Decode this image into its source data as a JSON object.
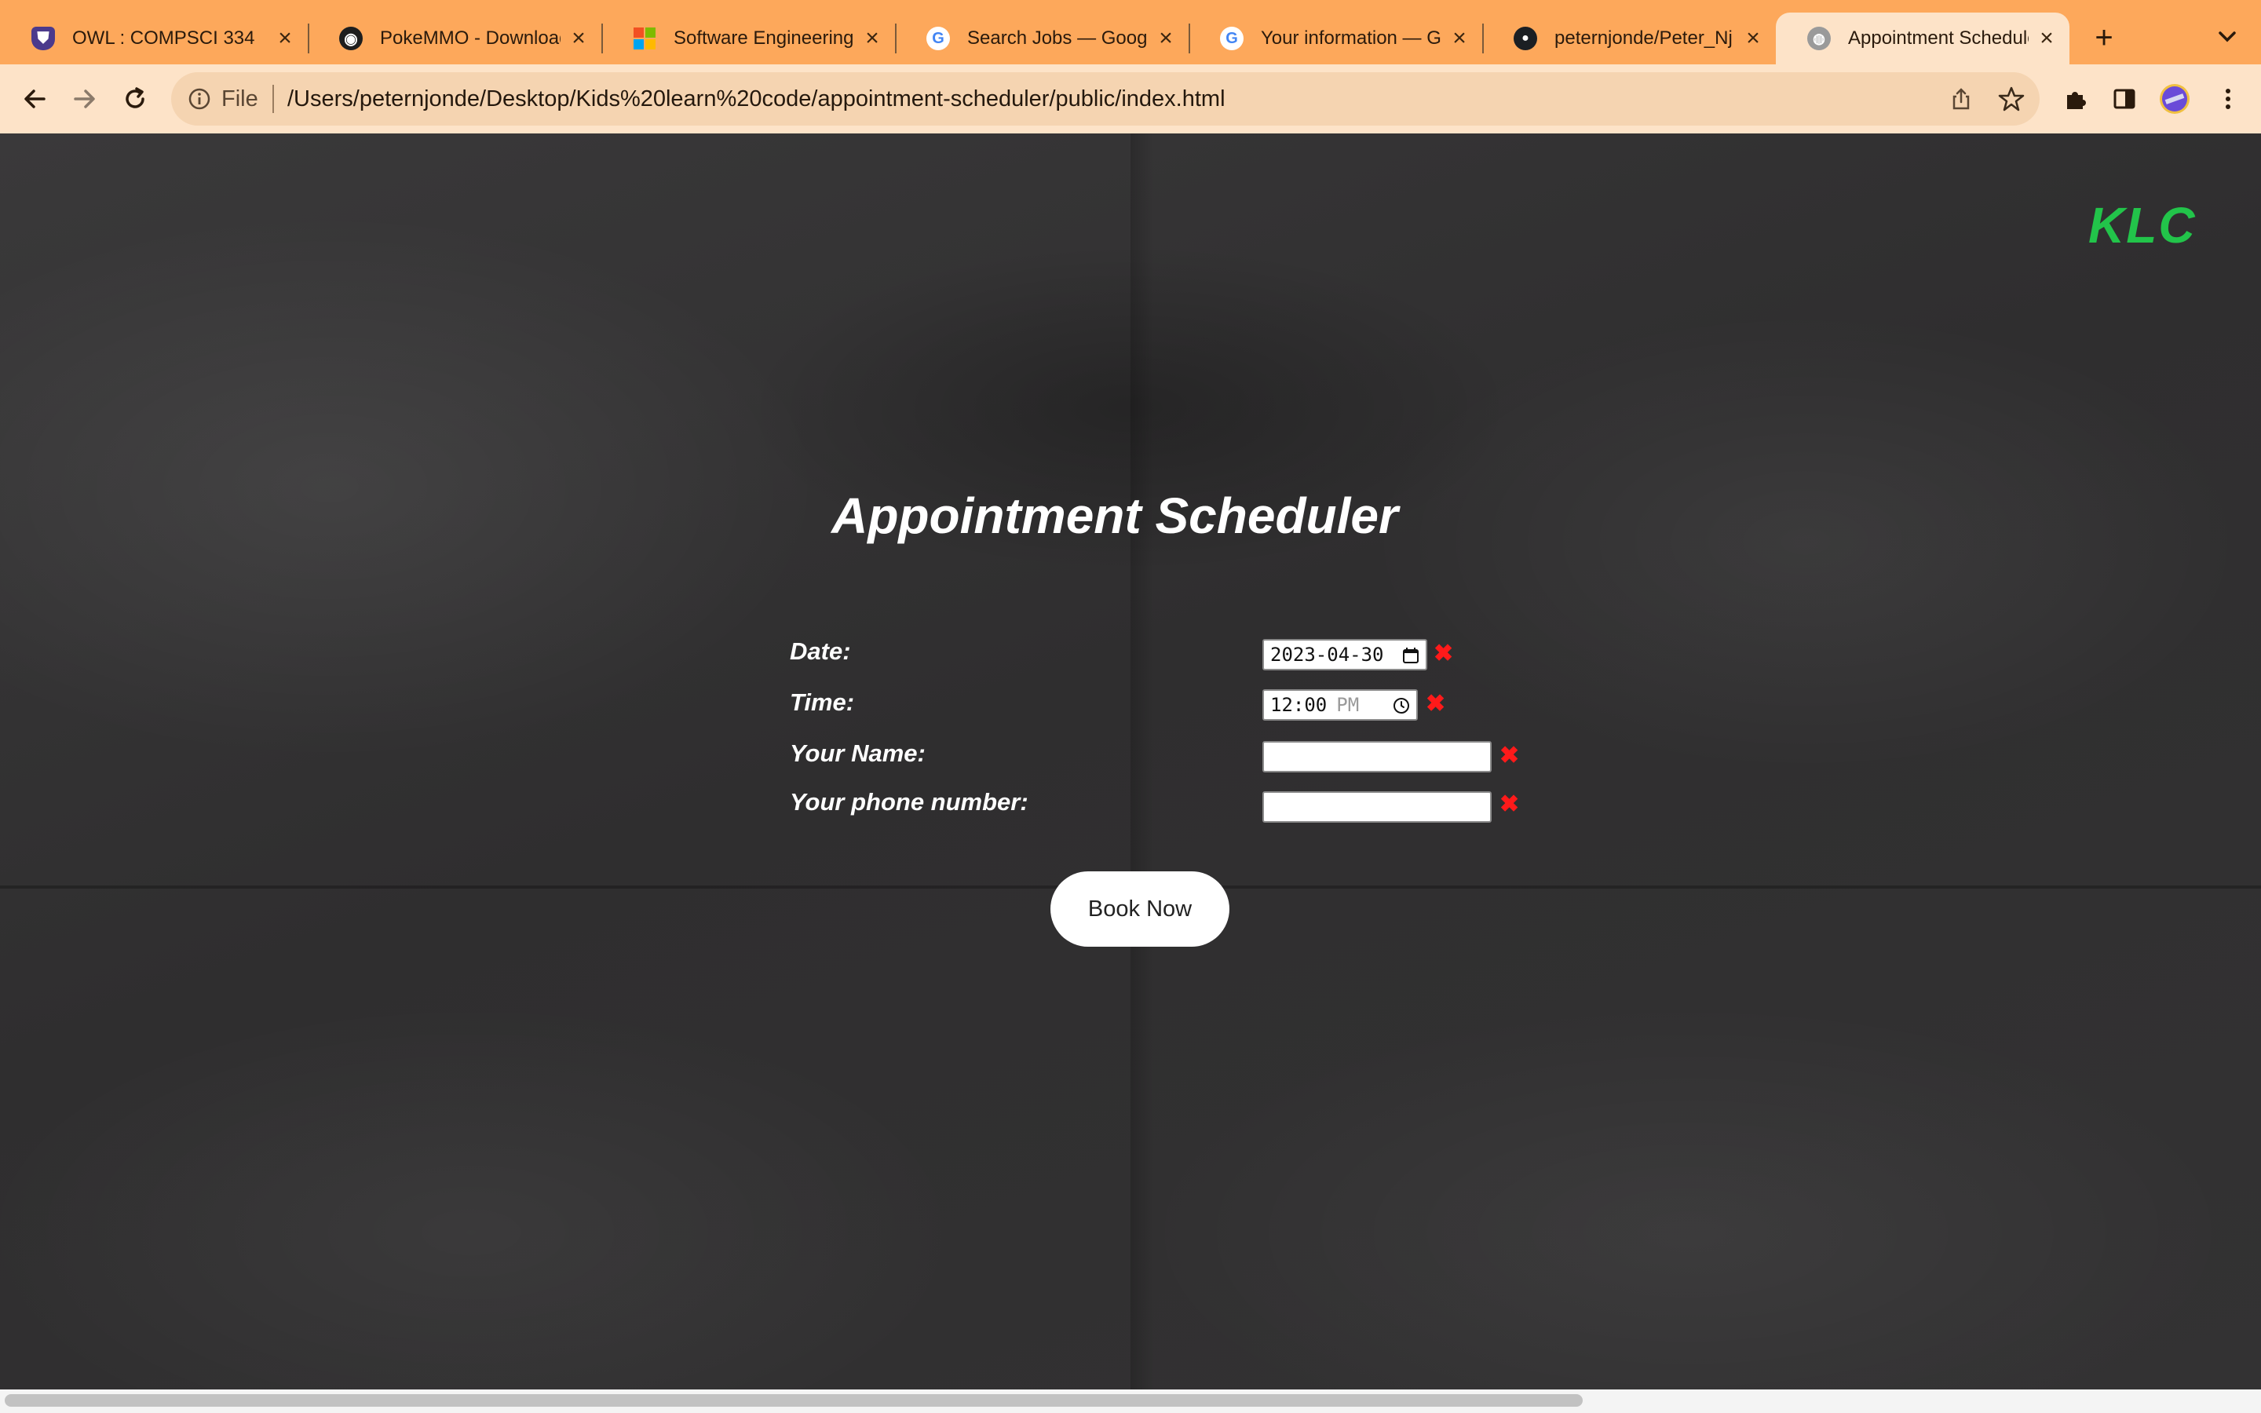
{
  "browser": {
    "tabs": [
      {
        "title": "OWL : COMPSCI 334",
        "icon": "owl-shield-icon",
        "color": "#4b3a8c"
      },
      {
        "title": "PokeMMO - Download",
        "icon": "pokemmo-icon",
        "color": "#222222"
      },
      {
        "title": "Software Engineering",
        "icon": "microsoft-icon",
        "color": "#f25022"
      },
      {
        "title": "Search Jobs — Google",
        "icon": "google-icon",
        "color": "#4285f4"
      },
      {
        "title": "Your information — Google",
        "icon": "google-icon",
        "color": "#4285f4"
      },
      {
        "title": "peternjonde/Peter_Nj",
        "icon": "github-icon",
        "color": "#1b1f23"
      },
      {
        "title": "Appointment Scheduler",
        "icon": "globe-icon",
        "color": "#8a8a8a"
      }
    ],
    "active_tab": 6,
    "address": {
      "scheme_label": "File",
      "url": "/Users/peternjonde/Desktop/Kids%20learn%20code/appointment-scheduler/public/index.html"
    }
  },
  "page": {
    "logo": "KLC",
    "title": "Appointment Scheduler",
    "form": {
      "date_label": "Date:",
      "date_value": "2023-04-30",
      "time_label": "Time:",
      "time_value": "12:00",
      "time_ampm": "PM",
      "name_label": "Your Name:",
      "name_value": "",
      "phone_label": "Your phone number:",
      "phone_value": "",
      "invalid_mark": "✖"
    },
    "book_button": "Book Now"
  },
  "colors": {
    "tab_bar": "#fda85b",
    "toolbar": "#fde3c8",
    "logo": "#22c44a",
    "invalid": "#ff1a1a"
  }
}
